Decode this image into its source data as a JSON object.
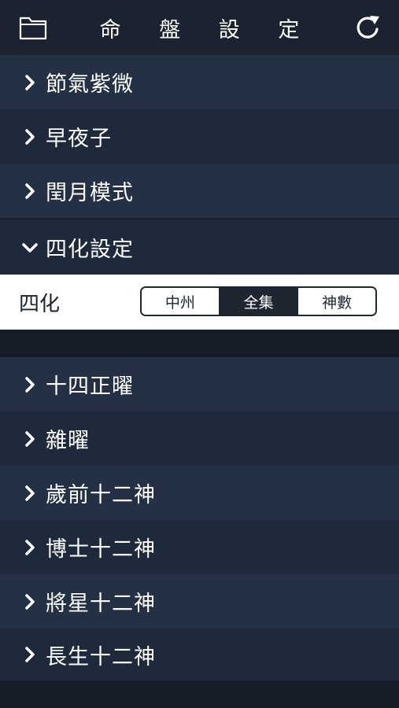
{
  "header": {
    "title": "命 盤 設 定",
    "left_icon": "folder-icon",
    "right_icon": "refresh-icon"
  },
  "menu_top": [
    {
      "label": "節氣紫微",
      "expanded": false
    },
    {
      "label": "早夜子",
      "expanded": false
    },
    {
      "label": "閏月模式",
      "expanded": false
    },
    {
      "label": "四化設定",
      "expanded": true
    }
  ],
  "sihua_panel": {
    "label": "四化",
    "options": [
      "中州",
      "全集",
      "神數"
    ],
    "selected": "全集"
  },
  "menu_bottom": [
    {
      "label": "十四正曜"
    },
    {
      "label": "雜曜"
    },
    {
      "label": "歲前十二神"
    },
    {
      "label": "博士十二神"
    },
    {
      "label": "將星十二神"
    },
    {
      "label": "長生十二神"
    }
  ],
  "colors": {
    "bg": "#1b2330",
    "row_light": "#243144",
    "row_dark": "#1e2a3b",
    "selected": "#1f2531"
  }
}
